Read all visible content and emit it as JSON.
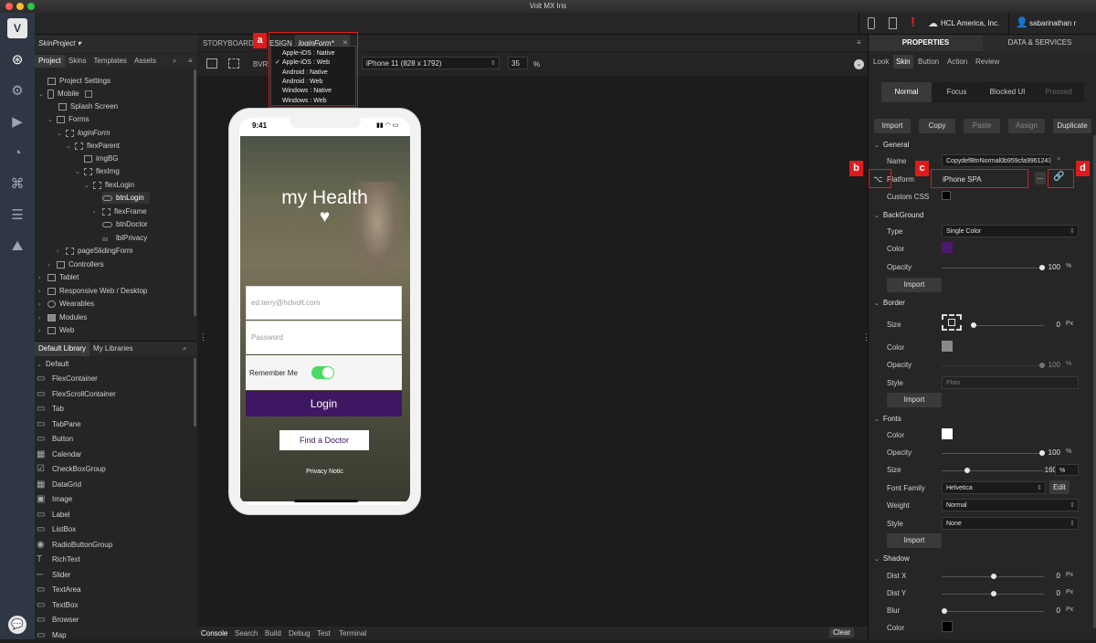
{
  "window": {
    "title": "Volt MX Iris"
  },
  "top_right": {
    "company": "HCL America, Inc.",
    "user": "sabarinathan r"
  },
  "left": {
    "project": "SkinProject",
    "tabs": [
      "Project",
      "Skins",
      "Templates",
      "Assets"
    ],
    "tree": [
      {
        "label": "Project Settings"
      },
      {
        "label": "Mobile"
      },
      {
        "label": "Splash Screen"
      },
      {
        "label": "Forms"
      },
      {
        "label": "loginForm"
      },
      {
        "label": "flexParent"
      },
      {
        "label": "imgBG"
      },
      {
        "label": "flexImg"
      },
      {
        "label": "flexLogin"
      },
      {
        "label": "btnLogin"
      },
      {
        "label": "flexFrame"
      },
      {
        "label": "btnDoctor"
      },
      {
        "label": "lblPrivacy"
      },
      {
        "label": "pageSlidingForm"
      },
      {
        "label": "Controllers"
      },
      {
        "label": "Tablet"
      },
      {
        "label": "Responsive Web / Desktop"
      },
      {
        "label": "Wearables"
      },
      {
        "label": "Modules"
      },
      {
        "label": "Web"
      }
    ],
    "lib_tabs": [
      "Default Library",
      "My Libraries"
    ],
    "lib_group": "Default",
    "lib_items": [
      "FlexContainer",
      "FlexScrollContainer",
      "Tab",
      "TabPane",
      "Button",
      "Calendar",
      "CheckBoxGroup",
      "DataGrid",
      "Image",
      "Label",
      "ListBox",
      "RadioButtonGroup",
      "RichText",
      "Slider",
      "TextArea",
      "TextBox",
      "Browser",
      "Map"
    ]
  },
  "center": {
    "tabs": {
      "storyboard": "STORYBOARD",
      "design": "ESIGN",
      "form": "loginForm*"
    },
    "toolbar": {
      "bvr": "BVR",
      "device": "iPhone 11 (828 x 1792)",
      "zoom": "35",
      "zoom_unit": "%"
    },
    "platform_menu": [
      "Apple-iOS : Native",
      "Apple-iOS : Web",
      "Android : Native",
      "Android : Web",
      "Windows : Native",
      "Windows : Web"
    ],
    "platform_checked_index": 1,
    "phone": {
      "time": "9:41",
      "app_title": "my Health",
      "email_placeholder": "ed.terry@hclvolt.com",
      "password_placeholder": "Password",
      "remember": "Remember Me",
      "login": "Login",
      "find_doctor": "Find a Doctor",
      "privacy": "Privacy Notic"
    },
    "bottom_tabs": [
      "Console",
      "Search",
      "Build",
      "Debug",
      "Test",
      "Terminal"
    ],
    "clear": "Clear"
  },
  "right": {
    "tabs": [
      "PROPERTIES",
      "DATA & SERVICES"
    ],
    "subtabs": [
      "Look",
      "Skin",
      "Button",
      "Action",
      "Review"
    ],
    "states": [
      "Normal",
      "Focus",
      "Blocked UI",
      "Pressed"
    ],
    "actions": [
      "Import",
      "Copy",
      "Paste",
      "Assign",
      "Duplicate"
    ],
    "general": {
      "title": "General",
      "name_label": "Name",
      "name_value": "CopydefBtnNormal0b959cfa9961243",
      "platform_label": "Platform",
      "platform_value": "iPhone SPA",
      "ellipsis": "...",
      "custom_css": "Custom CSS"
    },
    "background": {
      "title": "BackGround",
      "type_label": "Type",
      "type_value": "Single Color",
      "color_label": "Color",
      "color": "#4a1a6e",
      "opacity_label": "Opacity",
      "opacity": "100",
      "unit": "%",
      "import": "Import"
    },
    "border": {
      "title": "Border",
      "size_label": "Size",
      "size": "0",
      "size_unit": "Px",
      "color_label": "Color",
      "color": "#8a8a8a",
      "opacity_label": "Opacity",
      "opacity": "100",
      "unit": "%",
      "style_label": "Style",
      "style_value": "Plain",
      "import": "Import"
    },
    "fonts": {
      "title": "Fonts",
      "color_label": "Color",
      "color": "#ffffff",
      "opacity_label": "Opacity",
      "opacity": "100",
      "unit": "%",
      "size_label": "Size",
      "size": "160",
      "size_unit": "%",
      "family_label": "Font Family",
      "family_value": "Helvetica",
      "edit": "Edit",
      "weight_label": "Weight",
      "weight_value": "Normal",
      "style_label": "Style",
      "style_value": "None",
      "import": "Import"
    },
    "shadow": {
      "title": "Shadow",
      "distx_label": "Dist X",
      "distx": "0",
      "disty_label": "Dist Y",
      "disty": "0",
      "blur_label": "Blur",
      "blur": "0",
      "unit": "Px",
      "color_label": "Color",
      "color": "#000000"
    }
  },
  "callouts": [
    "a",
    "b",
    "c",
    "d"
  ],
  "colors": {
    "accent": "#4a1a6e",
    "callout": "#e01b1b",
    "rail": "#2f3744"
  }
}
